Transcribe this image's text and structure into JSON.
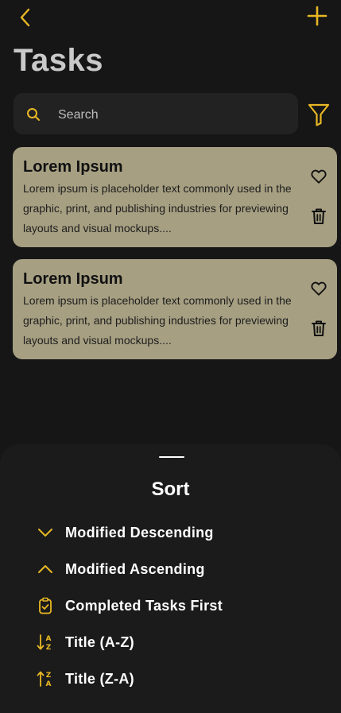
{
  "colors": {
    "accent": "#e8b824",
    "background": "#161616",
    "card": "#a69f82",
    "sheet": "#1b1b1b"
  },
  "header": {
    "title": "Tasks",
    "back_icon": "chevron-left-icon",
    "add_icon": "plus-icon"
  },
  "search": {
    "placeholder": "Search",
    "value": "",
    "icon": "search-icon"
  },
  "filter": {
    "icon": "filter-icon"
  },
  "tasks": [
    {
      "title": "Lorem Ipsum",
      "description": "Lorem ipsum is placeholder text commonly used in the graphic, print, and publishing industries for previewing layouts and visual mockups....",
      "favorite_icon": "heart-outline-icon",
      "delete_icon": "trash-icon"
    },
    {
      "title": "Lorem Ipsum",
      "description": "Lorem ipsum is placeholder text commonly used in the graphic, print, and publishing industries for previewing layouts and visual mockups....",
      "favorite_icon": "heart-outline-icon",
      "delete_icon": "trash-icon"
    }
  ],
  "sort_sheet": {
    "title": "Sort",
    "options": [
      {
        "label": "Modified Descending",
        "icon": "chevron-down-icon"
      },
      {
        "label": "Modified Ascending",
        "icon": "chevron-up-icon"
      },
      {
        "label": "Completed Tasks First",
        "icon": "clipboard-check-icon"
      },
      {
        "label": "Title (A-Z)",
        "icon": "sort-alpha-down-icon"
      },
      {
        "label": "Title (Z-A)",
        "icon": "sort-alpha-up-icon"
      }
    ]
  }
}
